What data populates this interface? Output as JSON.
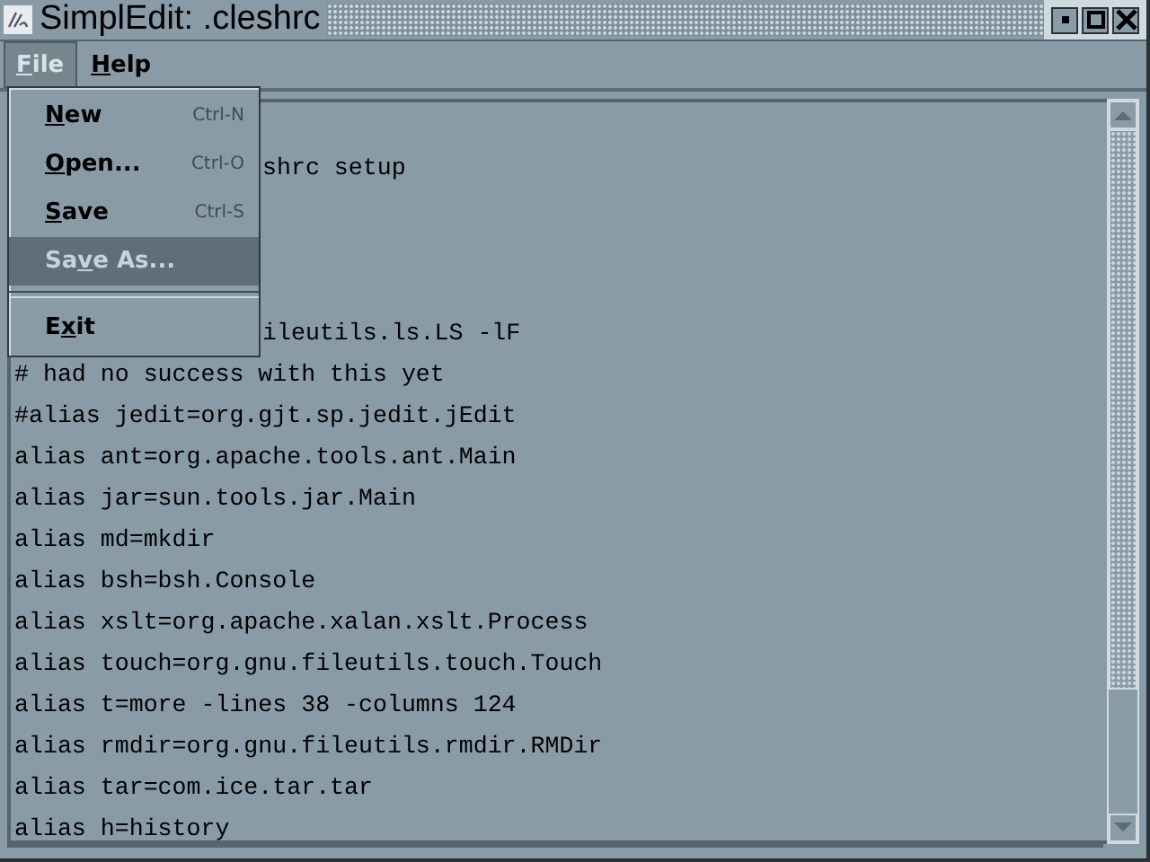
{
  "window": {
    "title": "SimplEdit: .cleshrc"
  },
  "menubar": [
    {
      "key": "F",
      "post": "ile",
      "selected": true
    },
    {
      "key": "H",
      "post": "elp",
      "selected": false
    }
  ],
  "menu": [
    {
      "kind": "item",
      "key": "N",
      "post": "ew",
      "shortcut": "Ctrl-N",
      "selected": false
    },
    {
      "kind": "item",
      "key": "O",
      "post": "pen...",
      "shortcut": "Ctrl-O",
      "selected": false
    },
    {
      "kind": "item",
      "key": "S",
      "post": "ave",
      "shortcut": "Ctrl-S",
      "selected": false
    },
    {
      "kind": "item",
      "pre": "Sa",
      "key": "v",
      "post": "e As...",
      "selected": true
    },
    {
      "kind": "separator"
    },
    {
      "kind": "item",
      "pre": "E",
      "key": "x",
      "post": "it",
      "selected": false
    }
  ],
  "editor": {
    "lines": [
      {
        "kind": "hidden"
      },
      {
        "kind": "partial",
        "text": "shrc setup"
      },
      {
        "kind": "hidden"
      },
      {
        "kind": "hidden"
      },
      {
        "kind": "hidden"
      },
      {
        "kind": "partial",
        "text": "ileutils.ls.LS -lF"
      },
      {
        "kind": "full",
        "text": "# had no success with this yet"
      },
      {
        "kind": "full",
        "text": "#alias jedit=org.gjt.sp.jedit.jEdit"
      },
      {
        "kind": "full",
        "text": "alias ant=org.apache.tools.ant.Main"
      },
      {
        "kind": "full",
        "text": "alias jar=sun.tools.jar.Main"
      },
      {
        "kind": "full",
        "text": "alias md=mkdir"
      },
      {
        "kind": "full",
        "text": "alias bsh=bsh.Console"
      },
      {
        "kind": "full",
        "text": "alias xslt=org.apache.xalan.xslt.Process"
      },
      {
        "kind": "full",
        "text": "alias touch=org.gnu.fileutils.touch.Touch"
      },
      {
        "kind": "full",
        "text": "alias t=more -lines 38 -columns 124"
      },
      {
        "kind": "full",
        "text": "alias rmdir=org.gnu.fileutils.rmdir.RMDir"
      },
      {
        "kind": "full",
        "text": "alias tar=com.ice.tar.tar"
      },
      {
        "kind": "full",
        "text": "alias h=history"
      }
    ]
  }
}
